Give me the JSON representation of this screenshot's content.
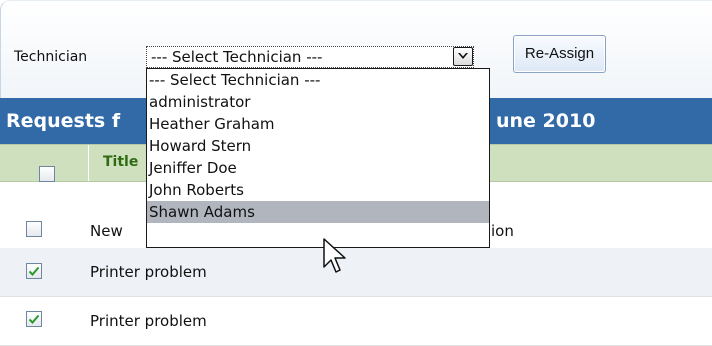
{
  "toolbar": {
    "technician_label": "Technician",
    "select_value": "--- Select Technician ---",
    "reassign_label": "Re-Assign"
  },
  "header": {
    "title_left": "Requests f",
    "title_right": "une 2010"
  },
  "dropdown": {
    "options": [
      "--- Select Technician ---",
      "administrator",
      "Heather Graham",
      "Howard Stern",
      "Jeniffer Doe",
      "John Roberts",
      "Shawn Adams"
    ],
    "highlighted": "Shawn Adams"
  },
  "table": {
    "column_title": "Title",
    "rows": [
      {
        "title_left": "New",
        "title_right": "ion",
        "checked": false
      },
      {
        "title": "Printer problem",
        "checked": true
      },
      {
        "title": "Printer problem",
        "checked": true
      }
    ]
  },
  "colors": {
    "header_bg": "#316aa6",
    "table_head_bg": "#cfe0bf",
    "checkmark": "#2a9a2a",
    "highlight_bg": "#b1b6be"
  }
}
